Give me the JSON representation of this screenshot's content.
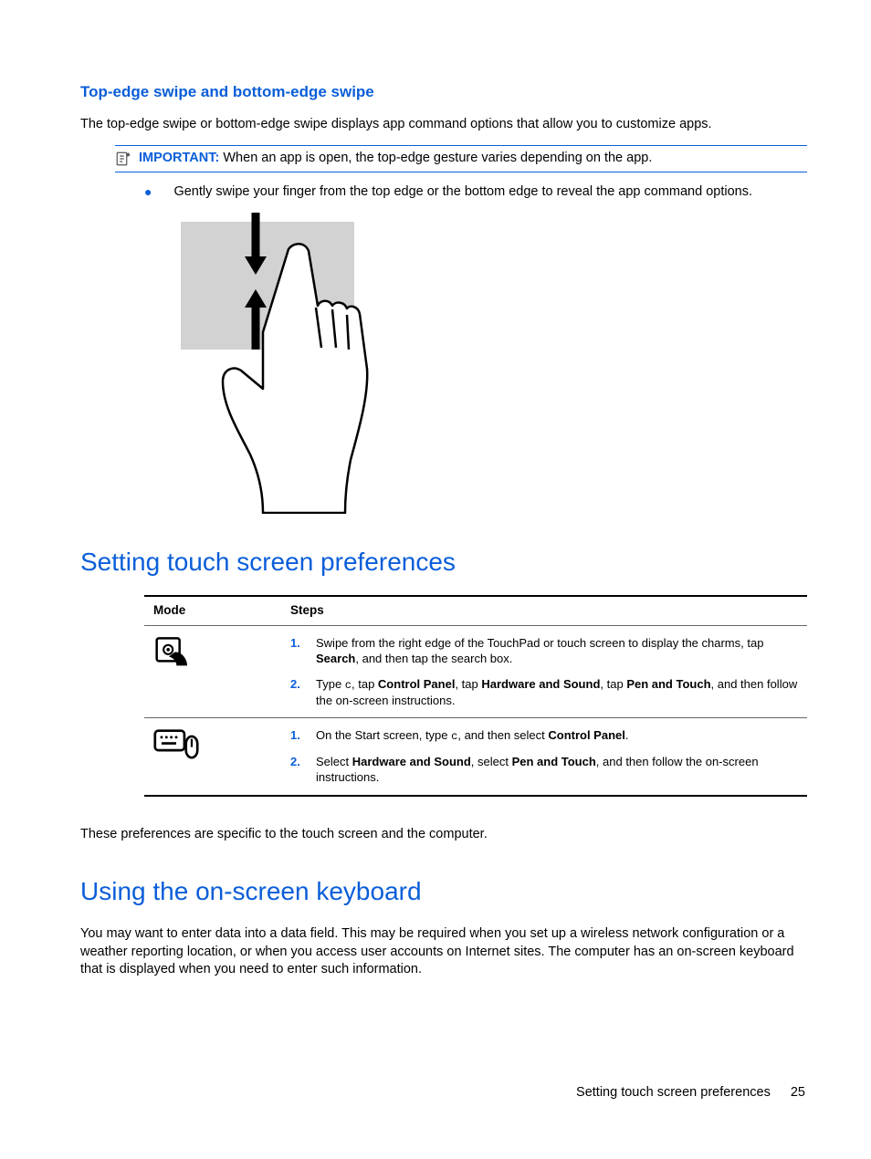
{
  "section1": {
    "title": "Top-edge swipe and bottom-edge swipe",
    "intro": "The top-edge swipe or bottom-edge swipe displays app command options that allow you to customize apps.",
    "important_label": "IMPORTANT:",
    "important_text": "When an app is open, the top-edge gesture varies depending on the app.",
    "bullet": "Gently swipe your finger from the top edge or the bottom edge to reveal the app command options."
  },
  "section2": {
    "title": "Setting touch screen preferences",
    "table": {
      "head_mode": "Mode",
      "head_steps": "Steps",
      "rows": [
        {
          "icon": "touch",
          "steps": [
            {
              "num": "1.",
              "parts": [
                "Swipe from the right edge of the TouchPad or touch screen to display the charms, tap ",
                {
                  "b": "Search"
                },
                ", and then tap the search box."
              ]
            },
            {
              "num": "2.",
              "parts": [
                "Type ",
                {
                  "c": "c"
                },
                ", tap ",
                {
                  "b": "Control Panel"
                },
                ", tap ",
                {
                  "b": "Hardware and Sound"
                },
                ", tap ",
                {
                  "b": "Pen and Touch"
                },
                ", and then follow the on-screen instructions."
              ]
            }
          ]
        },
        {
          "icon": "keyboard-mouse",
          "steps": [
            {
              "num": "1.",
              "parts": [
                "On the Start screen, type ",
                {
                  "c": "c"
                },
                ", and then select ",
                {
                  "b": "Control Panel"
                },
                "."
              ]
            },
            {
              "num": "2.",
              "parts": [
                "Select ",
                {
                  "b": "Hardware and Sound"
                },
                ", select ",
                {
                  "b": "Pen and Touch"
                },
                ", and then follow the on-screen instructions."
              ]
            }
          ]
        }
      ]
    },
    "after": "These preferences are specific to the touch screen and the computer."
  },
  "section3": {
    "title": "Using the on-screen keyboard",
    "para": "You may want to enter data into a data field. This may be required when you set up a wireless network configuration or a weather reporting location, or when you access user accounts on Internet sites. The computer has an on-screen keyboard that is displayed when you need to enter such information."
  },
  "footer": {
    "title": "Setting touch screen preferences",
    "page": "25"
  }
}
